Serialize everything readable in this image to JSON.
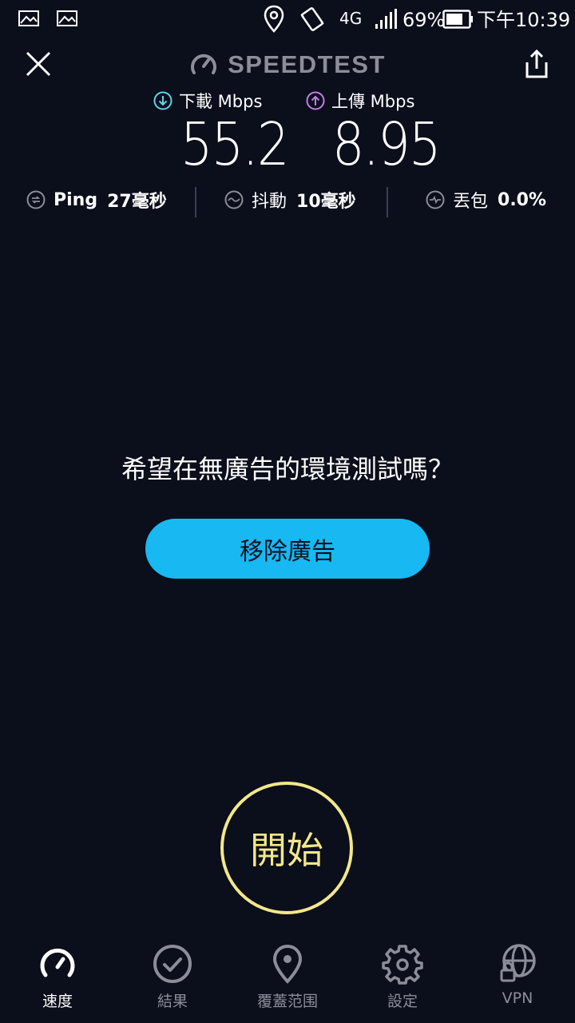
{
  "status_bar": {
    "battery": "69%",
    "network": "4G",
    "time": "下午10:39"
  },
  "header": {
    "brand": "SPEEDTEST"
  },
  "results": {
    "download_label": "下載 Mbps",
    "download_value": "55.2",
    "upload_label": "上傳 Mbps",
    "upload_value": "8.95",
    "ping_name": "Ping",
    "ping_value": "27毫秒",
    "jitter_name": "抖動",
    "jitter_value": "10毫秒",
    "loss_name": "丟包",
    "loss_value": "0.0%"
  },
  "ad": {
    "question": "希望在無廣告的環境測試嗎？",
    "button": "移除廣告"
  },
  "start_button": "開始",
  "nav": {
    "speed": "速度",
    "results": "結果",
    "coverage": "覆蓋范围",
    "settings": "設定",
    "vpn": "VPN"
  },
  "colors": {
    "background": "#0b0e1b",
    "download_accent": "#5fd3e8",
    "upload_accent": "#c47ce8",
    "remove_ad_button": "#18b8f2",
    "start_ring": "#f2e88a",
    "nav_inactive": "#8b8e98"
  }
}
